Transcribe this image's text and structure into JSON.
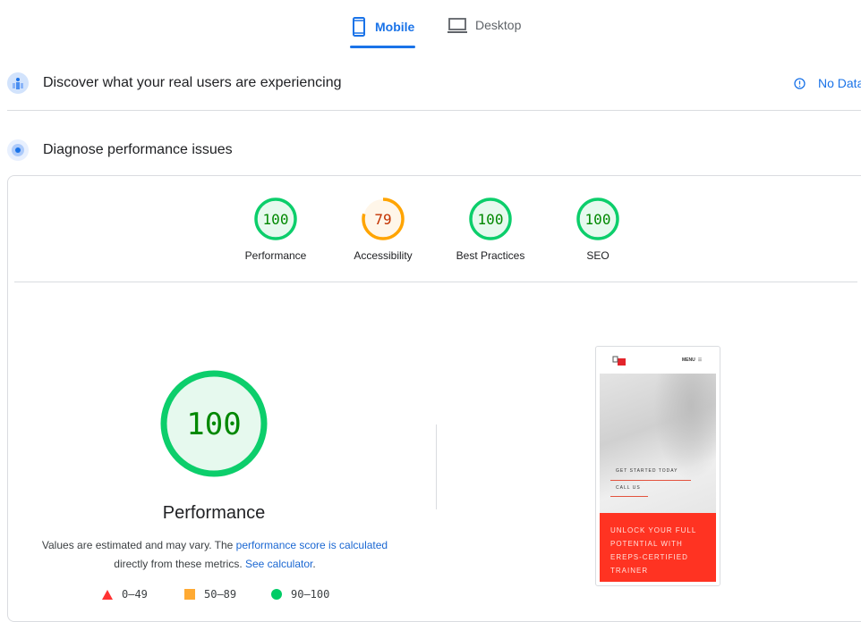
{
  "tabs": [
    {
      "label": "Mobile",
      "icon": "smartphone-icon",
      "active": true
    },
    {
      "label": "Desktop",
      "icon": "laptop-icon",
      "active": false
    }
  ],
  "field_section": {
    "title": "Discover what your real users are experiencing",
    "status": "No Data",
    "icon": "users-icon"
  },
  "lab_section": {
    "title": "Diagnose performance issues",
    "icon": "gauge-icon"
  },
  "scores": [
    {
      "label": "Performance",
      "value": "100",
      "score": 100,
      "status": "pass"
    },
    {
      "label": "Accessibility",
      "value": "79",
      "score": 79,
      "status": "average"
    },
    {
      "label": "Best Practices",
      "value": "100",
      "score": 100,
      "status": "pass"
    },
    {
      "label": "SEO",
      "value": "100",
      "score": 100,
      "status": "pass"
    }
  ],
  "main_gauge": {
    "value": "100",
    "label": "Performance"
  },
  "description": {
    "text1": "Values are estimated and may vary. The ",
    "link1": "performance score is calculated",
    "text2": " directly from these metrics. ",
    "link2": "See calculator",
    "text3": "."
  },
  "legend": [
    {
      "range": "0–49",
      "shape": "triangle",
      "color": "#ff3333"
    },
    {
      "range": "50–89",
      "shape": "square",
      "color": "#ffaa33"
    },
    {
      "range": "90–100",
      "shape": "circle",
      "color": "#00cc66"
    }
  ],
  "screenshot": {
    "menu": "MENU",
    "cta1": "GET STARTED TODAY",
    "cta2": "CALL US",
    "banner": "UNLOCK YOUR FULL POTENTIAL WITH EREPS-CERTIFIED TRAINER"
  },
  "colors": {
    "pass": "#0cce6b",
    "pass_text": "#008800",
    "pass_bg": "#e6f9ee",
    "average": "#ffa400",
    "average_text": "#c33300",
    "average_bg": "#fff6e9",
    "accent": "#1a73e8"
  }
}
